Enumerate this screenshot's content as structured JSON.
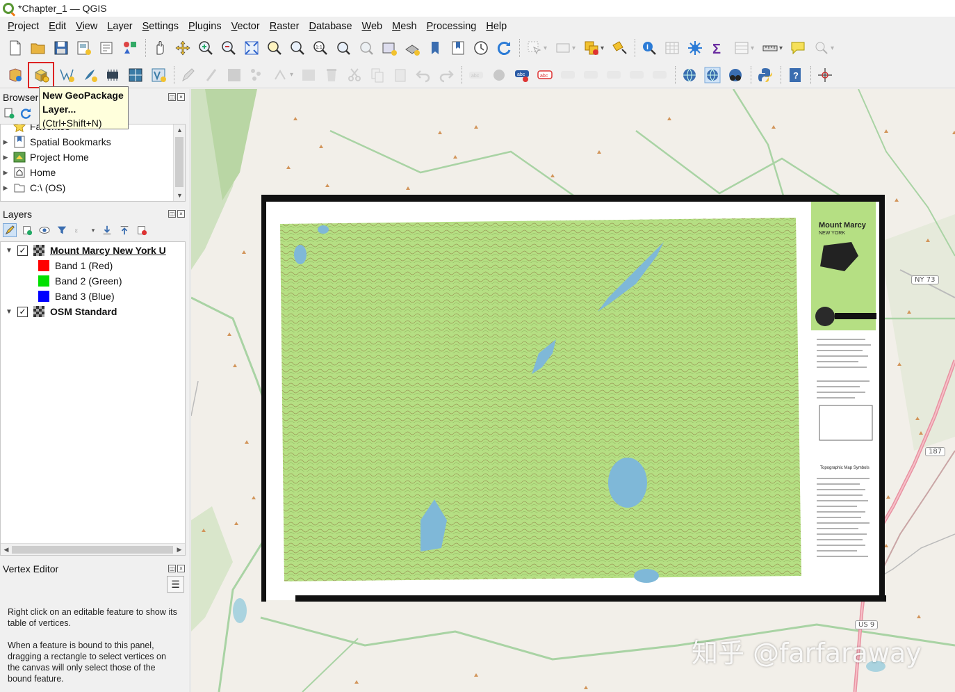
{
  "window": {
    "title": "*Chapter_1 — QGIS"
  },
  "menu": [
    "Project",
    "Edit",
    "View",
    "Layer",
    "Settings",
    "Plugins",
    "Vector",
    "Raster",
    "Database",
    "Web",
    "Mesh",
    "Processing",
    "Help"
  ],
  "tooltip": {
    "title_line1": "New GeoPackage",
    "title_line2": "Layer...",
    "shortcut": "(Ctrl+Shift+N)"
  },
  "browser": {
    "title": "Browser",
    "items": [
      {
        "label": "Favorites",
        "icon": "star-icon"
      },
      {
        "label": "Spatial Bookmarks",
        "icon": "bookmarks-icon"
      },
      {
        "label": "Project Home",
        "icon": "project-home-icon"
      },
      {
        "label": "Home",
        "icon": "home-icon"
      },
      {
        "label": "C:\\ (OS)",
        "icon": "drive-icon"
      }
    ]
  },
  "layers": {
    "title": "Layers",
    "items": [
      {
        "name": "Mount Marcy New York U",
        "checked": true,
        "bands": [
          {
            "label": "Band 1 (Red)",
            "color": "#ff0000"
          },
          {
            "label": "Band 2 (Green)",
            "color": "#00e000"
          },
          {
            "label": "Band 3 (Blue)",
            "color": "#0000ff"
          }
        ]
      },
      {
        "name": "OSM Standard",
        "checked": true
      }
    ]
  },
  "vertex_editor": {
    "title": "Vertex Editor",
    "paragraph1": "Right click on an editable feature to show its table of vertices.",
    "paragraph2": "When a feature is bound to this panel, dragging a rectangle to select vertices on the canvas will only select those of the bound feature."
  },
  "map": {
    "road_shields": [
      "NY 73",
      "187",
      "US 9"
    ],
    "watermark": "知乎 @farfaraway",
    "topo_title": "Mount Marcy",
    "topo_state": "NEW YORK",
    "topo_symbols": "Topographic Map Symbols"
  }
}
